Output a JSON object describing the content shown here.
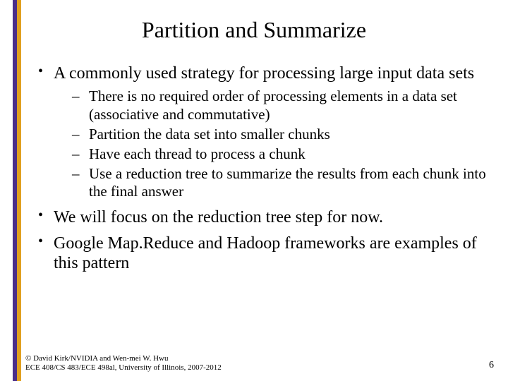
{
  "title": "Partition and Summarize",
  "bullets": [
    {
      "text": "A commonly used strategy for processing large input data sets",
      "sub": [
        "There is no required order of processing elements in a data set  (associative and commutative)",
        "Partition the data set into smaller chunks",
        "Have each thread to process a chunk",
        "Use a reduction tree to summarize the results from each chunk into the final answer"
      ]
    },
    {
      "text": "We will focus on the reduction tree step for now.",
      "sub": []
    },
    {
      "text": "Google Map.Reduce and Hadoop frameworks are examples of this pattern",
      "sub": []
    }
  ],
  "footer": {
    "line1": "© David Kirk/NVIDIA and Wen-mei W. Hwu",
    "line2": "ECE 408/CS 483/ECE 498al, University of Illinois, 2007-2012"
  },
  "page_number": "6"
}
